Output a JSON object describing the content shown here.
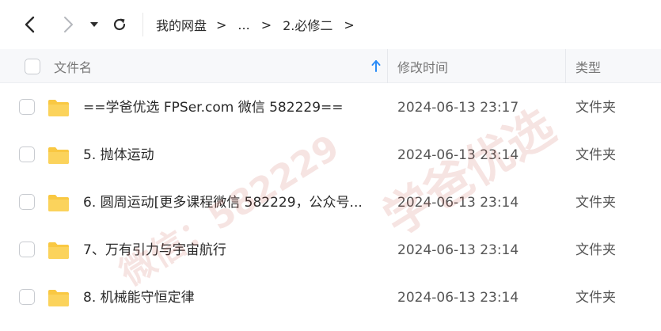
{
  "breadcrumb": {
    "items": [
      "我的网盘",
      "...",
      "2.必修二"
    ],
    "separator": ">"
  },
  "columns": {
    "name": "文件名",
    "modified": "修改时间",
    "type": "类型"
  },
  "files": [
    {
      "name": "==学爸优选 FPSer.com 微信 582229==",
      "modified": "2024-06-13 23:17",
      "type": "文件夹"
    },
    {
      "name": "5. 抛体运动",
      "modified": "2024-06-13 23:14",
      "type": "文件夹"
    },
    {
      "name": "6. 圆周运动[更多课程微信 582229，公众号...",
      "modified": "2024-06-13 23:14",
      "type": "文件夹"
    },
    {
      "name": "7、万有引力与宇宙航行",
      "modified": "2024-06-13 23:14",
      "type": "文件夹"
    },
    {
      "name": "8. 机械能守恒定律",
      "modified": "2024-06-13 23:14",
      "type": "文件夹"
    }
  ],
  "watermark": {
    "lines": [
      "学爸优选",
      "微信：582229"
    ]
  },
  "colors": {
    "folder": "#f9c842",
    "sort_arrow": "#2b8cf7",
    "header_bg": "#f7f8fa",
    "watermark": "#c0392b"
  },
  "icons": {
    "back": "chevron-left-icon",
    "forward": "chevron-right-icon",
    "dropdown": "caret-down-icon",
    "refresh": "refresh-icon",
    "sort": "sort-ascending-icon",
    "folder": "folder-icon"
  }
}
